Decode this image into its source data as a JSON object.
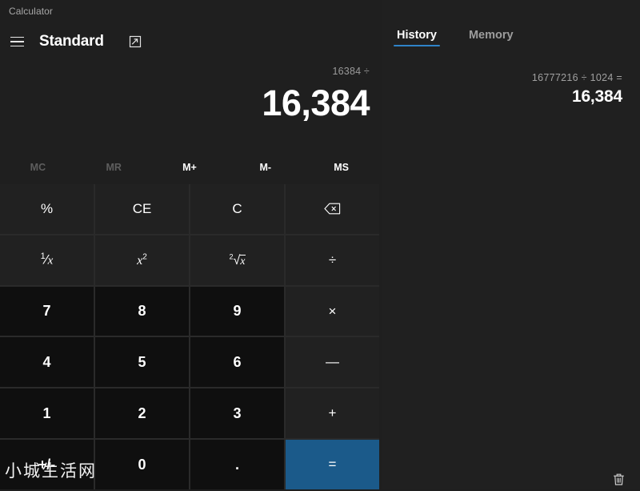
{
  "window": {
    "title": "Calculator",
    "controls": [
      {
        "name": "minimize",
        "glyph": "minimize-icon"
      },
      {
        "name": "maximize",
        "glyph": "maximize-icon"
      },
      {
        "name": "close",
        "glyph": "close-icon"
      }
    ]
  },
  "header": {
    "menu_icon": "hamburger-menu-icon",
    "mode_title": "Standard",
    "keep_on_top_icon": "keep-on-top-icon"
  },
  "display": {
    "expression": "16384 ÷",
    "result": "16,384"
  },
  "memory": {
    "buttons": [
      {
        "label": "MC",
        "enabled": false
      },
      {
        "label": "MR",
        "enabled": false
      },
      {
        "label": "M+",
        "enabled": true
      },
      {
        "label": "M-",
        "enabled": true
      },
      {
        "label": "MS",
        "enabled": true
      }
    ]
  },
  "keypad": {
    "rows": [
      [
        {
          "label": "%",
          "type": "op",
          "name": "percent"
        },
        {
          "label": "CE",
          "type": "op",
          "name": "clear-entry"
        },
        {
          "label": "C",
          "type": "op",
          "name": "clear"
        },
        {
          "label": "",
          "type": "op",
          "name": "backspace",
          "icon": "backspace-icon"
        }
      ],
      [
        {
          "label": "1/x",
          "type": "op",
          "name": "reciprocal"
        },
        {
          "label": "x2",
          "type": "op",
          "name": "square"
        },
        {
          "label": "2√x",
          "type": "op",
          "name": "square-root"
        },
        {
          "label": "÷",
          "type": "op",
          "name": "divide"
        }
      ],
      [
        {
          "label": "7",
          "type": "num",
          "name": "seven"
        },
        {
          "label": "8",
          "type": "num",
          "name": "eight"
        },
        {
          "label": "9",
          "type": "num",
          "name": "nine"
        },
        {
          "label": "×",
          "type": "op",
          "name": "multiply"
        }
      ],
      [
        {
          "label": "4",
          "type": "num",
          "name": "four"
        },
        {
          "label": "5",
          "type": "num",
          "name": "five"
        },
        {
          "label": "6",
          "type": "num",
          "name": "six"
        },
        {
          "label": "—",
          "type": "op",
          "name": "subtract"
        }
      ],
      [
        {
          "label": "1",
          "type": "num",
          "name": "one"
        },
        {
          "label": "2",
          "type": "num",
          "name": "two"
        },
        {
          "label": "3",
          "type": "num",
          "name": "three"
        },
        {
          "label": "+",
          "type": "op",
          "name": "add"
        }
      ],
      [
        {
          "label": "+/-",
          "type": "num",
          "name": "negate"
        },
        {
          "label": "0",
          "type": "num",
          "name": "zero"
        },
        {
          "label": ".",
          "type": "num",
          "name": "decimal"
        },
        {
          "label": "=",
          "type": "equals",
          "name": "equals"
        }
      ]
    ]
  },
  "history": {
    "tabs": [
      {
        "label": "History",
        "active": true
      },
      {
        "label": "Memory",
        "active": false
      }
    ],
    "items": [
      {
        "expression": "16777216  ÷  1024 =",
        "result": "16,384"
      }
    ],
    "clear_icon": "trash-icon"
  },
  "watermark": {
    "text": "小城生活网"
  },
  "colors": {
    "accent": "#1b5a8a",
    "tab_underline": "#2f83c8",
    "body_bg": "#1f1f1f",
    "num_key_bg": "#0f0f0f",
    "op_key_bg": "#212121",
    "history_bg": "#202020"
  }
}
